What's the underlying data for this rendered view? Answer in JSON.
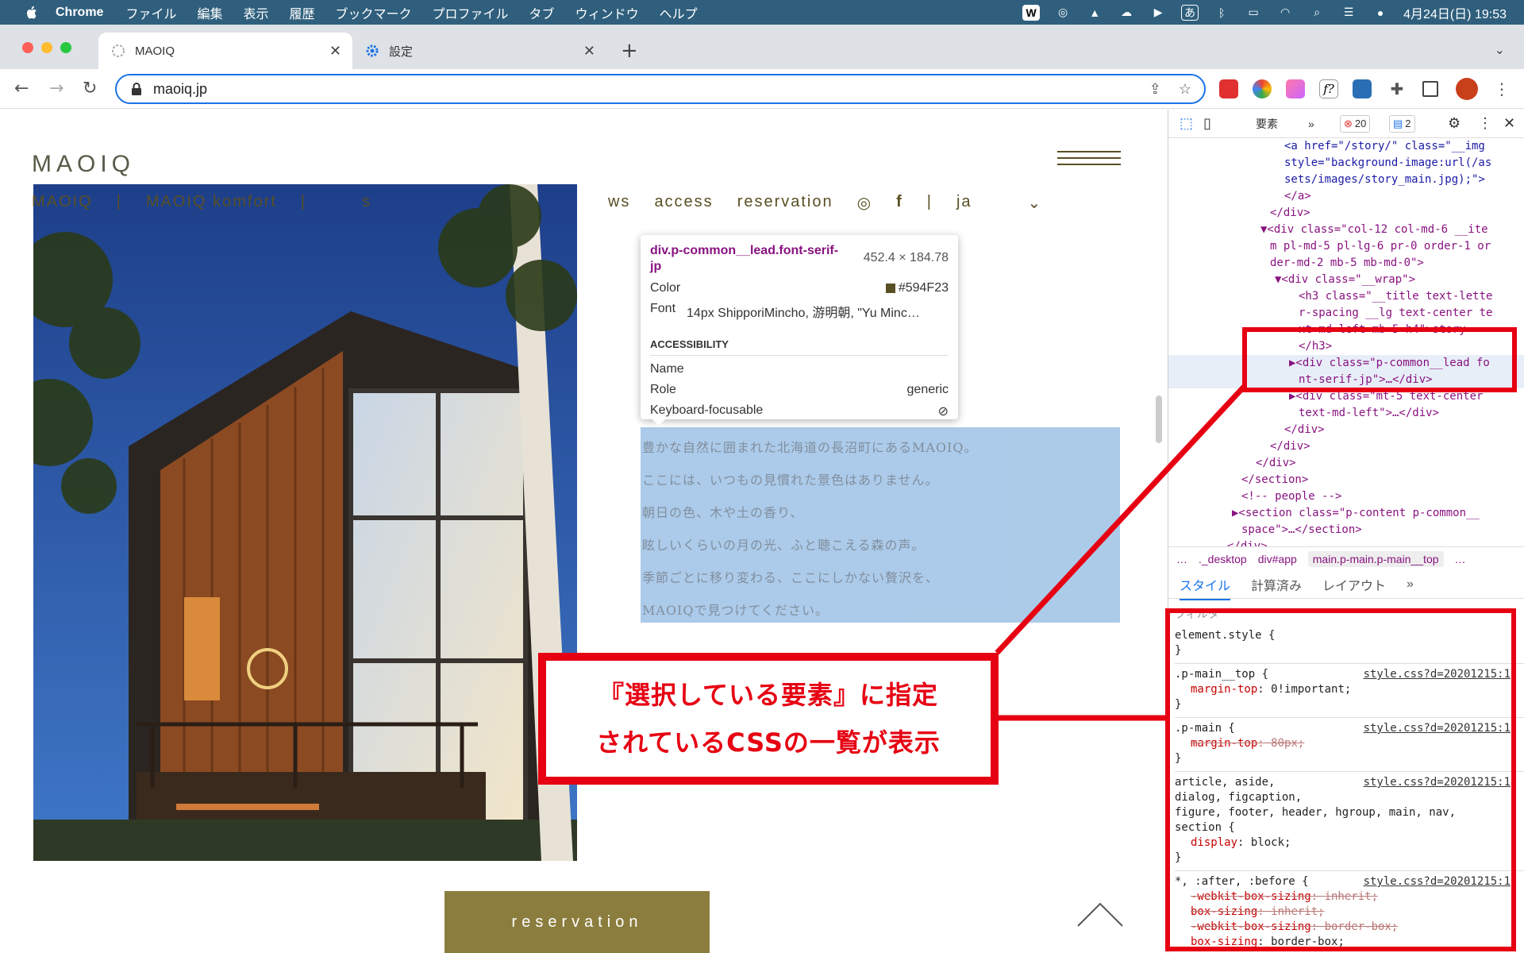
{
  "menubar": {
    "app": "Chrome",
    "items": [
      "ファイル",
      "編集",
      "表示",
      "履歴",
      "ブックマーク",
      "プロファイル",
      "タブ",
      "ウィンドウ",
      "ヘルプ"
    ],
    "datetime": "4月24日(日) 19:53"
  },
  "tabs": [
    {
      "title": "MAOIQ",
      "active": true
    },
    {
      "title": "設定",
      "active": false
    }
  ],
  "omnibox": {
    "url": "maoiq.jp"
  },
  "site": {
    "logo": "MAOIQ",
    "nav": [
      "MAOIQ",
      "|",
      "MAOIQ komfort",
      "|",
      "s",
      "ws",
      "access",
      "reservation",
      "|",
      "ja"
    ],
    "lead_lines": [
      "豊かな自然に囲まれた北海道の長沼町にあるMAOIQ。",
      "ここには、いつもの見慣れた景色はありません。",
      "朝日の色、木や土の香り、",
      "眩しいくらいの月の光、ふと聴こえる森の声。",
      "季節ごとに移り変わる、ここにしかない贅沢を、",
      "MAOIQで見つけてください。"
    ],
    "reservation_button": "reservation"
  },
  "tooltip": {
    "selector": "div.p-common__lead.font-serif-jp",
    "size": "452.4 × 184.78",
    "color_label": "Color",
    "color_value": "#594F23",
    "font_label": "Font",
    "font_value": "14px ShipporiMincho, 游明朝, \"Yu Minc…",
    "accessibility_heading": "ACCESSIBILITY",
    "name_label": "Name",
    "role_label": "Role",
    "role_value": "generic",
    "kbd_label": "Keyboard-focusable"
  },
  "devtools": {
    "tab_elements": "要素",
    "errors": "20",
    "messages": "2",
    "tree": [
      "<a href=\"/story/\" class=\"__img",
      "style=\"background-image:url(/as",
      "sets/images/story_main.jpg);\">",
      "</a>",
      "</div>",
      "▼<div class=\"col-12 col-md-6 __ite",
      "m pl-md-5 pl-lg-6 pr-0 order-1 or",
      "der-md-2 mb-5 mb-md-0\">",
      "▼<div class=\"__wrap\">",
      "<h3 class=\"__title text-lette",
      "r-spacing __lg text-center te",
      "xt-md-left mb-5 h4\">story",
      "</h3>",
      "▶<div class=\"p-common__lead fo",
      "nt-serif-jp\">…</div>",
      "▶<div class=\"mt-5 text-center",
      "text-md-left\">…</div>",
      "</div>",
      "</div>",
      "</div>",
      "</section>",
      "<!-- people -->",
      "▶<section class=\"p-content p-common__",
      "space\">…</section>",
      "</div>"
    ],
    "breadcrumbs": [
      "…",
      "._desktop",
      "div#app",
      "main.p-main.p-main__top",
      "…"
    ],
    "style_tabs": [
      "スタイル",
      "計算済み",
      "レイアウト",
      "»"
    ],
    "filter_placeholder": "フィルタ",
    "rules": [
      {
        "selector": "element.style {",
        "source": "",
        "props": [],
        "close": "}"
      },
      {
        "selector": ".p-main__top {",
        "source": "style.css?d=20201215:1",
        "props": [
          {
            "name": "margin-top",
            "value": "0!important;",
            "struck": false
          }
        ],
        "close": "}"
      },
      {
        "selector": ".p-main {",
        "source": "style.css?d=20201215:1",
        "props": [
          {
            "name": "margin-top",
            "value": "80px;",
            "struck": true
          }
        ],
        "close": "}"
      },
      {
        "selector": "article, aside,\ndialog, figcaption,\nfigure, footer, header, hgroup, main, nav,\nsection {",
        "source": "style.css?d=20201215:1",
        "props": [
          {
            "name": "display",
            "value": "block;",
            "struck": false
          }
        ],
        "close": "}"
      },
      {
        "selector": "*, :after, :before {",
        "source": "style.css?d=20201215:1",
        "props": [
          {
            "name": "-webkit-box-sizing",
            "value": "inherit;",
            "struck": true
          },
          {
            "name": "box-sizing",
            "value": "inherit;",
            "struck": true
          },
          {
            "name": "-webkit-box-sizing",
            "value": "border-box;",
            "struck": true
          },
          {
            "name": "box-sizing",
            "value": "border-box;",
            "struck": false
          }
        ],
        "close": ""
      }
    ]
  },
  "annotation": {
    "line1": "『選択している要素』に指定",
    "line2": "されているCSSの一覧が表示",
    "color": "#e60012"
  }
}
